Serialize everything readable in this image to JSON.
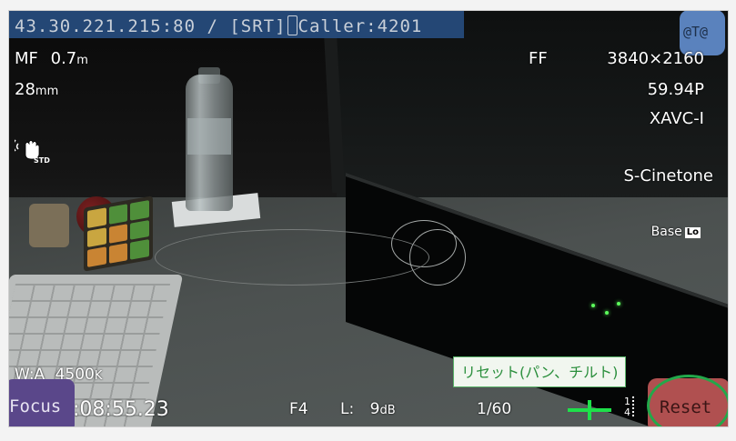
{
  "connection": {
    "address_label": "43.30.221.215:80 / [SRT]",
    "caller_label": "Caller:4201"
  },
  "top_right_button": {
    "label": "@T@"
  },
  "osd_left": {
    "focus_mode": "MF",
    "focus_distance": "0.7",
    "focus_unit": "m",
    "focal_length": "28",
    "focal_unit": "mm",
    "stabilizer_label": "STD",
    "white_balance": "W:A",
    "color_temp": "4500",
    "color_temp_unit": "K"
  },
  "osd_right": {
    "ff": "FF",
    "resolution": "3840×2160",
    "frame_rate": "59.94P",
    "codec": "XAVC-I",
    "picture_profile": "S-Cinetone",
    "base_iso_label": "Base",
    "base_iso_value": "Lo"
  },
  "osd_bottom": {
    "timecode": ":08:55.23",
    "iris": "F4",
    "audio_level_label": "L:",
    "audio_level_value": "9",
    "audio_level_unit": "dB",
    "shutter": "1/60",
    "audio_channels": [
      "1",
      "4"
    ]
  },
  "buttons": {
    "focus": "Focus",
    "reset": "Reset"
  },
  "tooltip": {
    "text": "リセット(パン、チルト)"
  },
  "colors": {
    "ip_bar": "#254a7a",
    "focus_button": "#5a478a",
    "reset_button": "#b05050",
    "highlight_ring": "#23a84a",
    "level_marker": "#1ee04a"
  },
  "icons": [
    "stabilizer-hand-icon",
    "level-crosshair-icon",
    "audio-meter-icon"
  ]
}
